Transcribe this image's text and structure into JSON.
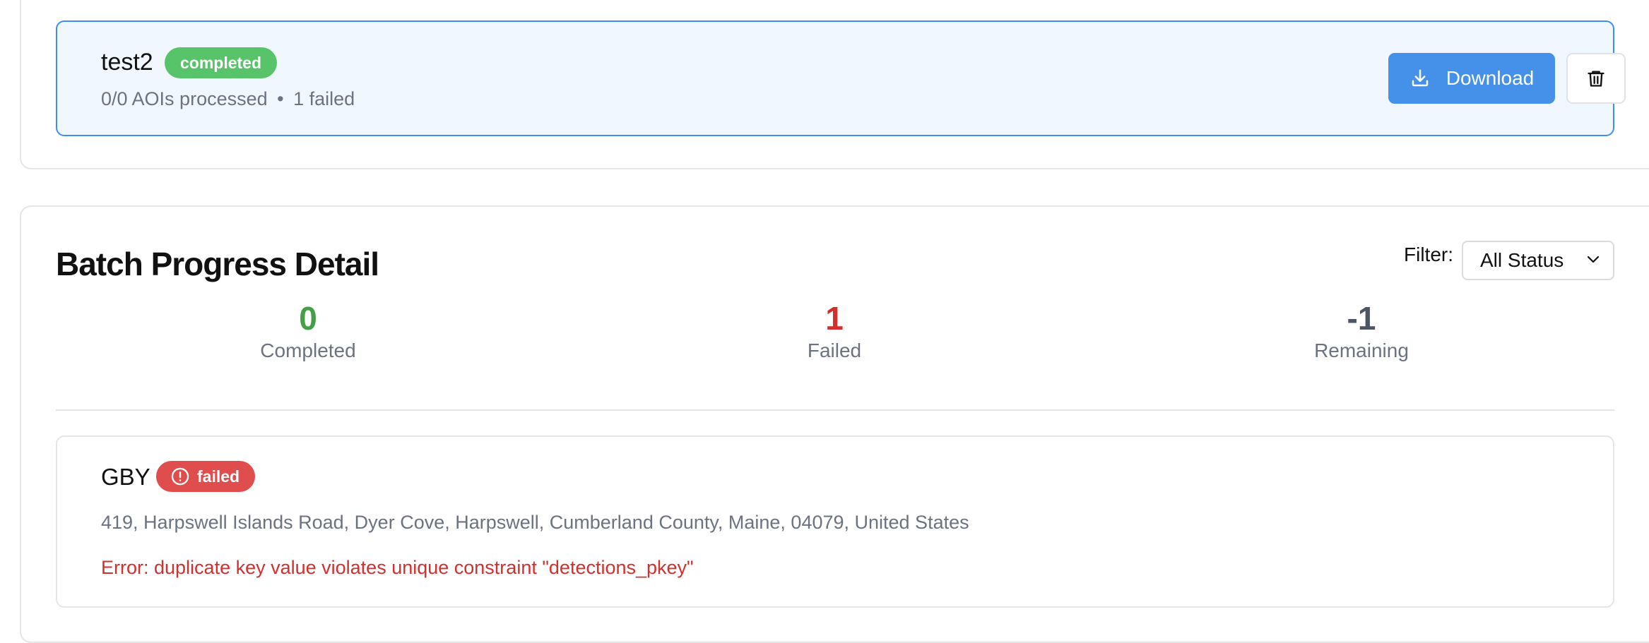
{
  "job": {
    "name": "test2",
    "status": "completed",
    "processed": "0/0 AOIs processed",
    "separator": "•",
    "failed": "1 failed",
    "download_label": "Download",
    "delete_icon": "trash-icon",
    "download_icon": "download-icon"
  },
  "detail": {
    "title": "Batch Progress Detail",
    "filter_label": "Filter:",
    "filter_value": "All Status"
  },
  "stats": [
    {
      "value": "0",
      "label": "Completed",
      "color": "#43a047"
    },
    {
      "value": "1",
      "label": "Failed",
      "color": "#d32f2f"
    },
    {
      "value": "-1",
      "label": "Remaining",
      "color": "#4b5563"
    }
  ],
  "aoi": {
    "name": "GBY",
    "status": "failed",
    "address": "419, Harpswell Islands Road, Dyer Cove, Harpswell, Cumberland County, Maine, 04079, United States",
    "error": "Error: duplicate key value violates unique constraint \"detections_pkey\""
  },
  "colors": {
    "accent": "#4591ea",
    "success": "#57c46a",
    "danger": "#e04d4d"
  }
}
